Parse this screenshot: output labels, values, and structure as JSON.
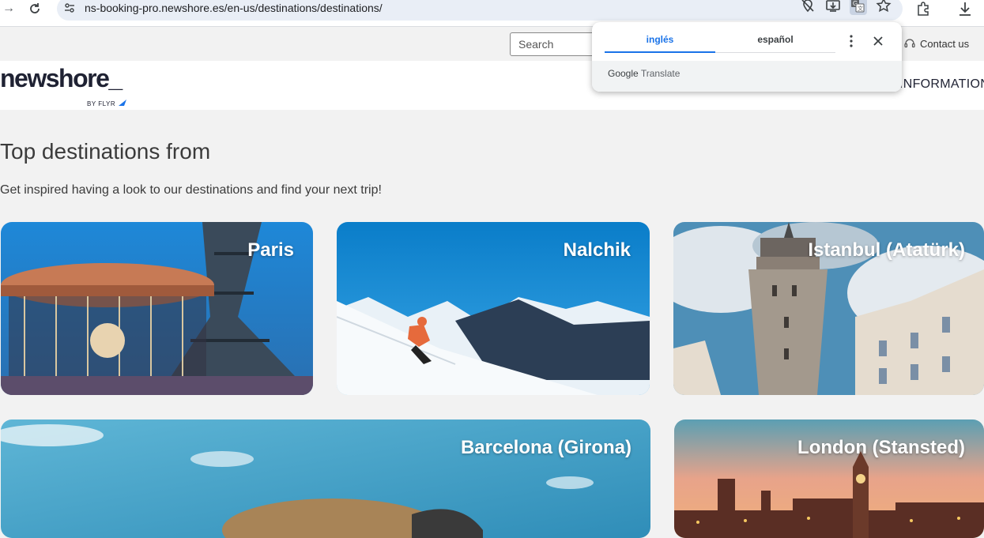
{
  "browser": {
    "url": "ns-booking-pro.newshore.es/en-us/destinations/destinations/"
  },
  "site": {
    "search_placeholder": "Search",
    "contact_label": "Contact us",
    "logo_text": "newshore_",
    "logo_sub": "BY FLYR",
    "nav_information": "INFORMATION"
  },
  "translate_popup": {
    "tab_source": "inglés",
    "tab_target": "español",
    "brand_google": "Google",
    "brand_translate": "Translate"
  },
  "main": {
    "title": "Top destinations from",
    "subtitle": "Get inspired having a look to our destinations and find your next trip!",
    "destinations": [
      {
        "name": "Paris"
      },
      {
        "name": "Nalchik"
      },
      {
        "name": "Istanbul (Atatürk)"
      },
      {
        "name": "Barcelona (Girona)"
      },
      {
        "name": "London (Stansted)"
      }
    ]
  },
  "colors": {
    "accent_blue": "#1a73e8",
    "brand_dark": "#1f2233",
    "page_bg": "#f2f2f2"
  }
}
